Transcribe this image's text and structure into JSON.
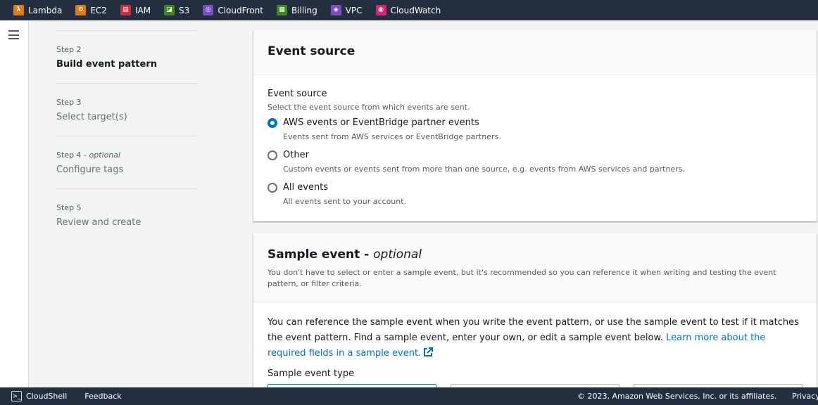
{
  "favorites": [
    {
      "label": "Lambda",
      "glyph": "λ",
      "color": "#e07b18"
    },
    {
      "label": "EC2",
      "glyph": "⚙",
      "color": "#e07b18"
    },
    {
      "label": "IAM",
      "glyph": "▤",
      "color": "#c7303d"
    },
    {
      "label": "S3",
      "glyph": "◪",
      "color": "#3f8624"
    },
    {
      "label": "CloudFront",
      "glyph": "◎",
      "color": "#7b4cc4"
    },
    {
      "label": "Billing",
      "glyph": "▦",
      "color": "#3f8624"
    },
    {
      "label": "VPC",
      "glyph": "◈",
      "color": "#7b4cc4"
    },
    {
      "label": "CloudWatch",
      "glyph": "◉",
      "color": "#d6246e"
    }
  ],
  "steps": [
    {
      "num": "Step 2",
      "optional": "",
      "title": "Build event pattern",
      "active": true
    },
    {
      "num": "Step 3",
      "optional": "",
      "title": "Select target(s)",
      "active": false
    },
    {
      "num": "Step 4 - ",
      "optional": "optional",
      "title": "Configure tags",
      "active": false
    },
    {
      "num": "Step 5",
      "optional": "",
      "title": "Review and create",
      "active": false
    }
  ],
  "event_source": {
    "title": "Event source",
    "field_label": "Event source",
    "field_desc": "Select the event source from which events are sent.",
    "options": [
      {
        "label": "AWS events or EventBridge partner events",
        "desc": "Events sent from AWS services or EventBridge partners.",
        "checked": true
      },
      {
        "label": "Other",
        "desc": "Custom events or events sent from more than one source, e.g. events from AWS services and partners.",
        "checked": false
      },
      {
        "label": "All events",
        "desc": "All events sent to your account.",
        "checked": false
      }
    ]
  },
  "sample_event": {
    "title": "Sample event - ",
    "title_optional": "optional",
    "desc": "You don't have to select or enter a sample event, but it's recommended so you can reference it when writing and testing the event pattern, or filter criteria.",
    "body_text": "You can reference the sample event when you write the event pattern, or use the sample event to test if it matches the event pattern. Find a sample event, enter your own, or edit a sample event below. ",
    "link_text": "Learn more about the required fields in a sample event.",
    "type_label": "Sample event type"
  },
  "footer": {
    "cloudshell": "CloudShell",
    "feedback": "Feedback",
    "copyright": "© 2023, Amazon Web Services, Inc. or its affiliates.",
    "privacy": "Privacy"
  },
  "colors": {
    "accent": "#0073bb",
    "topbar": "#232f3e"
  }
}
